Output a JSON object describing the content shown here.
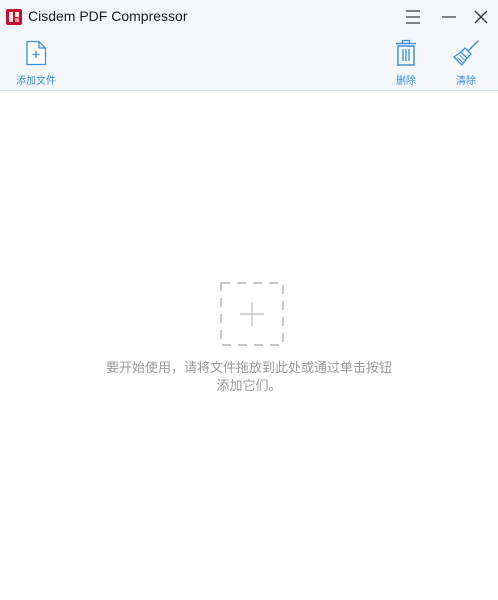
{
  "app": {
    "title": "Cisdem PDF Compressor"
  },
  "toolbar": {
    "add_files_label": "添加文件",
    "delete_label": "删除",
    "clear_label": "清除"
  },
  "dropzone": {
    "hint_line1": "要开始使用，请将文件拖放到此处或通过单击按钮",
    "hint_line2": "添加它们。"
  },
  "icons": {
    "app_logo": "cisdem-logo-icon",
    "menu": "hamburger-menu-icon",
    "minimize": "minimize-icon",
    "close": "close-icon",
    "add_file": "add-file-icon",
    "delete": "trash-icon",
    "clear": "broom-icon",
    "drop_plus": "plus-icon"
  },
  "colors": {
    "accent": "#3b8fdc",
    "toolbar_bg": "#f4f7fa",
    "logo_red": "#c8102e",
    "hint_text": "#9a9a9a"
  }
}
